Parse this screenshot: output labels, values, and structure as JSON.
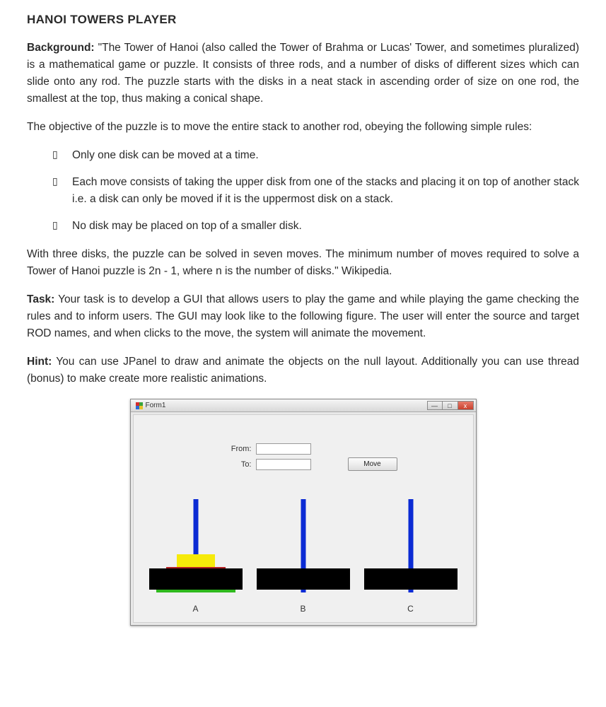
{
  "heading": "HANOI TOWERS PLAYER",
  "background_label": "Background:",
  "background_p1": "\"The Tower of Hanoi (also called the Tower of Brahma or Lucas' Tower, and sometimes pluralized) is a mathematical game or puzzle. It consists of three rods, and a number of disks of different sizes which can slide onto any rod. The puzzle starts with the disks in a neat stack in ascending order of size on one rod, the smallest at the top, thus making a conical shape.",
  "objective_intro": "The objective of the puzzle is to move the entire stack to another rod, obeying the following simple rules:",
  "rules": [
    "Only one disk can be moved at a time.",
    "Each move consists of taking the upper disk from one of the stacks and placing it on top of another stack i.e. a disk can only be moved if it is the uppermost disk on a stack.",
    "No disk may be placed on top of a smaller disk."
  ],
  "background_close": "With three disks, the puzzle can be solved in seven moves. The minimum number of moves required to solve a Tower of Hanoi puzzle is 2n - 1, where n is the number of disks.\" Wikipedia.",
  "task_label": "Task:",
  "task_text": "Your task is to develop a GUI that allows users to play the game and while playing the game checking the rules and to inform users. The GUI may look like to the following figure. The user will enter the source and target ROD names, and when clicks to the move, the system will animate the movement.",
  "hint_label": "Hint:",
  "hint_text": "You can use JPanel to draw and animate the objects on the null layout. Additionally you can use thread (bonus) to make create more realistic animations.",
  "window": {
    "title": "Form1",
    "controls": {
      "min": "—",
      "max": "□",
      "close": "x"
    },
    "from_label": "From:",
    "to_label": "To:",
    "from_value": "",
    "to_value": "",
    "move_label": "Move",
    "rod_labels": [
      "A",
      "B",
      "C"
    ]
  }
}
